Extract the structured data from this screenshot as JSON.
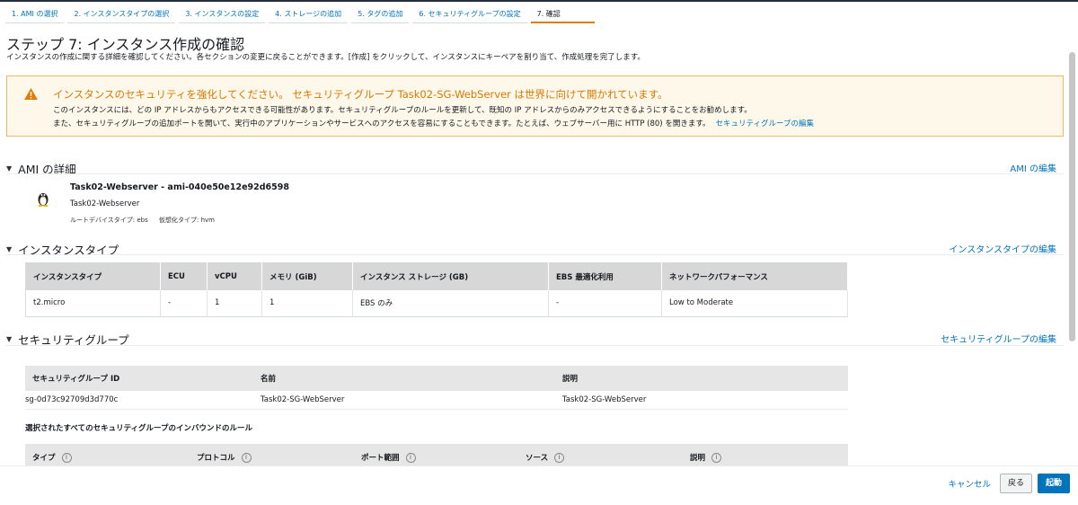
{
  "wizard": {
    "steps": [
      "1. AMI の選択",
      "2. インスタンスタイプの選択",
      "3. インスタンスの設定",
      "4. ストレージの追加",
      "5. タグの追加",
      "6. セキュリティグループの設定",
      "7. 確認"
    ],
    "active_index": 6
  },
  "page": {
    "title": "ステップ 7: インスタンス作成の確認",
    "description": "インスタンスの作成に関する詳細を確認してください。各セクションの変更に戻ることができます。[作成] をクリックして、インスタンスにキーペアを割り当て、作成処理を完了します。"
  },
  "warning": {
    "title": "インスタンスのセキュリティを強化してください。 セキュリティグループ Task02-SG-WebServer は世界に向けて開かれています。",
    "line1": "このインスタンスには、どの IP アドレスからもアクセスできる可能性があります。セキュリティグループのルールを更新して、既知の IP アドレスからのみアクセスできるようにすることをお勧めします。",
    "line2": "また、セキュリティグループの追加ポートを開いて、実行中のアプリケーションやサービスへのアクセスを容易にすることもできます。たとえば、ウェブサーバー用に HTTP (80) を開きます。",
    "link": "セキュリティグループの編集",
    "color": "#d97800"
  },
  "ami": {
    "heading": "AMI の詳細",
    "edit": "AMI の編集",
    "name": "Task02-Webserver - ami-040e50e12e92d6598",
    "subtitle": "Task02-Webserver",
    "root_device": "ルートデバイスタイプ: ebs",
    "virt_type": "仮想化タイプ: hvm",
    "icon": "linux-penguin-icon"
  },
  "instance_type": {
    "heading": "インスタンスタイプ",
    "edit": "インスタンスタイプの編集",
    "columns": [
      "インスタンスタイプ",
      "ECU",
      "vCPU",
      "メモリ (GiB)",
      "インスタンス ストレージ (GB)",
      "EBS 最適化利用",
      "ネットワークパフォーマンス"
    ],
    "rows": [
      [
        "t2.micro",
        "-",
        "1",
        "1",
        "EBS のみ",
        "-",
        "Low to Moderate"
      ]
    ]
  },
  "security_group": {
    "heading": "セキュリティグループ",
    "edit": "セキュリティグループの編集",
    "columns": [
      "セキュリティグループ ID",
      "名前",
      "説明"
    ],
    "rows": [
      [
        "sg-0d73c92709d3d770c",
        "Task02-SG-WebServer",
        "Task02-SG-WebServer"
      ]
    ],
    "inbound_title": "選択されたすべてのセキュリティグループのインバウンドのルール",
    "inbound_columns": [
      "タイプ",
      "プロトコル",
      "ポート範囲",
      "ソース",
      "説明"
    ]
  },
  "footer": {
    "cancel": "キャンセル",
    "back": "戻る",
    "launch": "起動",
    "primary_color": "#0073bb"
  }
}
